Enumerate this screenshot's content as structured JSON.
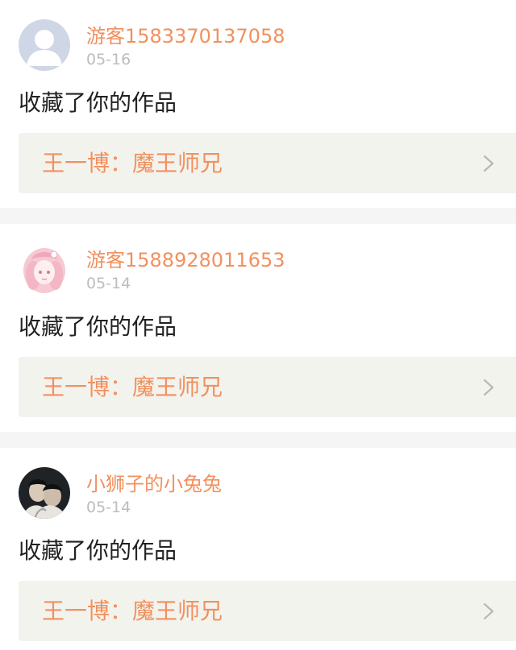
{
  "feed": [
    {
      "username": "游客1583370137058",
      "date": "05-16",
      "action": "收藏了你的作品",
      "work_title": "王一博：魔王师兄",
      "avatar": "default-avatar"
    },
    {
      "username": "游客1588928011653",
      "date": "05-14",
      "action": "收藏了你的作品",
      "work_title": "王一博：魔王师兄",
      "avatar": "anime-girl-avatar"
    },
    {
      "username": "小狮子的小兔兔",
      "date": "05-14",
      "action": "收藏了你的作品",
      "work_title": "王一博：魔王师兄",
      "avatar": "photo-avatar"
    }
  ],
  "colors": {
    "accent": "#f2905e",
    "date": "#bdbdbd",
    "text": "#222222",
    "link_bg": "#f3f3ee",
    "separator": "#f5f5f5"
  }
}
